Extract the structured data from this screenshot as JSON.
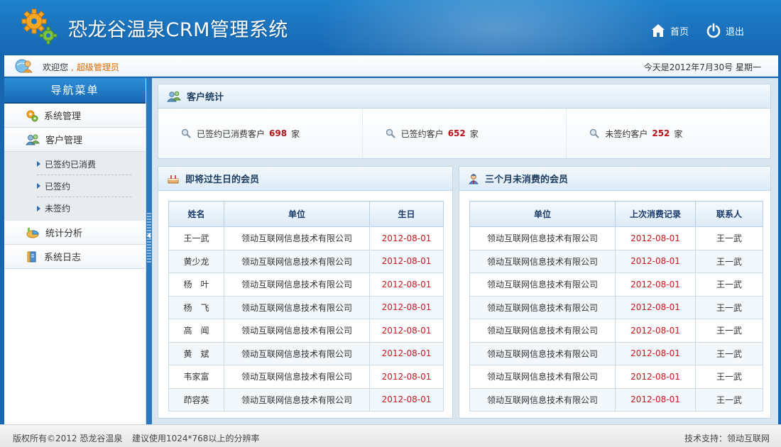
{
  "app": {
    "title": "恐龙谷温泉CRM管理系统"
  },
  "header": {
    "home_label": "首页",
    "logout_label": "退出"
  },
  "statusbar": {
    "welcome_prefix": "欢迎您",
    "separator": ",",
    "user": "超级管理员",
    "today": "今天是2012年7月30号  星期一"
  },
  "sidebar": {
    "title": "导航菜单",
    "items": [
      {
        "label": "系统管理",
        "icon": "gears-icon"
      },
      {
        "label": "客户管理",
        "icon": "users-icon"
      },
      {
        "label": "统计分析",
        "icon": "chart-icon"
      },
      {
        "label": "系统日志",
        "icon": "log-book-icon"
      }
    ],
    "subitems": [
      {
        "label": "已签约已消费"
      },
      {
        "label": "已签约"
      },
      {
        "label": "未签约"
      }
    ]
  },
  "stats": {
    "title": "客户统计",
    "cells": [
      {
        "label": "已签约已消费客户",
        "value": "698",
        "unit": "家"
      },
      {
        "label": "已签约客户",
        "value": "652",
        "unit": "家"
      },
      {
        "label": "未签约客户",
        "value": "252",
        "unit": "家"
      }
    ]
  },
  "birthday": {
    "title": "即将过生日的会员",
    "columns": [
      "姓名",
      "单位",
      "生日"
    ],
    "rows": [
      [
        "王一武",
        "领动互联网信息技术有限公司",
        "2012-08-01"
      ],
      [
        "黄少龙",
        "领动互联网信息技术有限公司",
        "2012-08-01"
      ],
      [
        "杨　叶",
        "领动互联网信息技术有限公司",
        "2012-08-01"
      ],
      [
        "杨　飞",
        "领动互联网信息技术有限公司",
        "2012-08-01"
      ],
      [
        "高　闻",
        "领动互联网信息技术有限公司",
        "2012-08-01"
      ],
      [
        "黄　斌",
        "领动互联网信息技术有限公司",
        "2012-08-01"
      ],
      [
        "韦家富",
        "领动互联网信息技术有限公司",
        "2012-08-01"
      ],
      [
        "茚容英",
        "领动互联网信息技术有限公司",
        "2012-08-01"
      ]
    ]
  },
  "inactive": {
    "title": "三个月未消费的会员",
    "columns": [
      "单位",
      "上次消费记录",
      "联系人"
    ],
    "rows": [
      [
        "领动互联网信息技术有限公司",
        "2012-08-01",
        "王一武"
      ],
      [
        "领动互联网信息技术有限公司",
        "2012-08-01",
        "王一武"
      ],
      [
        "领动互联网信息技术有限公司",
        "2012-08-01",
        "王一武"
      ],
      [
        "领动互联网信息技术有限公司",
        "2012-08-01",
        "王一武"
      ],
      [
        "领动互联网信息技术有限公司",
        "2012-08-01",
        "王一武"
      ],
      [
        "领动互联网信息技术有限公司",
        "2012-08-01",
        "王一武"
      ],
      [
        "领动互联网信息技术有限公司",
        "2012-08-01",
        "王一武"
      ],
      [
        "领动互联网信息技术有限公司",
        "2012-08-01",
        "王一武"
      ]
    ]
  },
  "footer": {
    "copyright": "版权所有©2012 恐龙谷温泉",
    "suggest": "建议使用1024*768以上的分辨率",
    "support": "技术支持：领动互联网"
  },
  "colors": {
    "brand_blue": "#1b74bf",
    "accent_orange": "#e06a00",
    "date_red": "#c8161d"
  }
}
